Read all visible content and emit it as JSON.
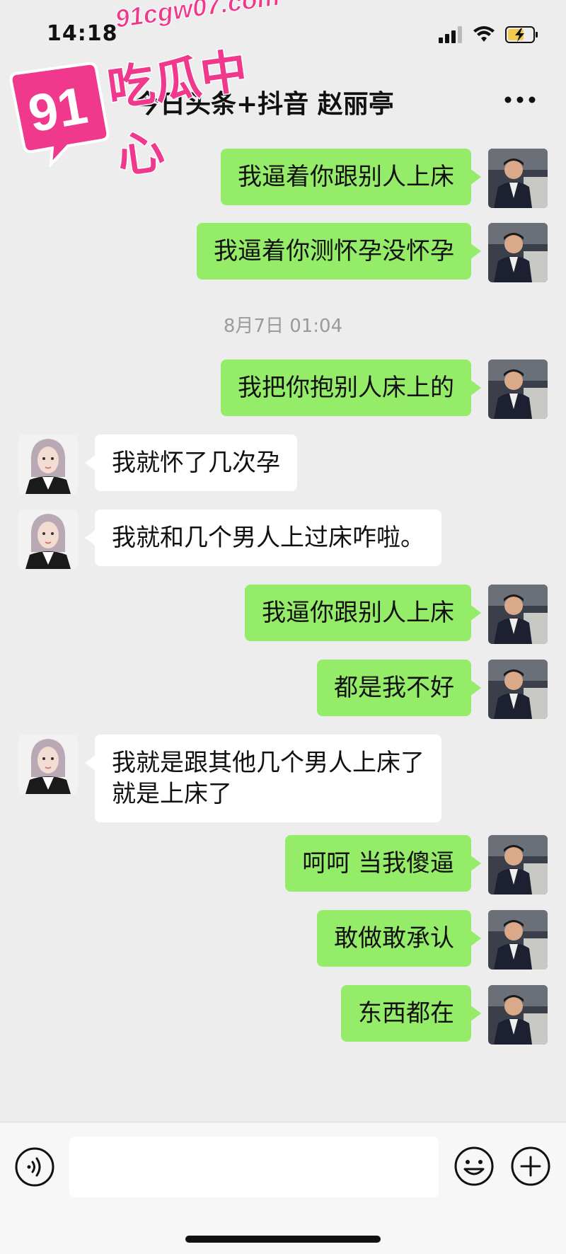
{
  "status_bar": {
    "time": "14:18"
  },
  "nav": {
    "title": "今日头条+抖音 赵丽亭"
  },
  "watermark": {
    "badge_text": "91",
    "url": "91cgw07.com",
    "name": "吃瓜中心"
  },
  "messages": [
    {
      "side": "me",
      "text": "我逼着你跟别人上床"
    },
    {
      "side": "me",
      "text": "我逼着你测怀孕没怀孕"
    },
    {
      "type": "timestamp",
      "text": "8月7日 01:04"
    },
    {
      "side": "me",
      "text": "我把你抱别人床上的"
    },
    {
      "side": "her",
      "text": "我就怀了几次孕"
    },
    {
      "side": "her",
      "text": "我就和几个男人上过床咋啦。"
    },
    {
      "side": "me",
      "text": "我逼你跟别人上床"
    },
    {
      "side": "me",
      "text": "都是我不好"
    },
    {
      "side": "her",
      "lines": [
        "我就是跟其他几个男人上床了",
        "就是上床了"
      ]
    },
    {
      "side": "me",
      "text": "呵呵 当我傻逼"
    },
    {
      "side": "me",
      "text": "敢做敢承认"
    },
    {
      "side": "me",
      "text": "东西都在"
    }
  ],
  "input_bar": {
    "value": ""
  },
  "colors": {
    "sent_bubble": "#95ec69",
    "received_bubble": "#ffffff",
    "background": "#ededed",
    "watermark": "#f0388c"
  }
}
